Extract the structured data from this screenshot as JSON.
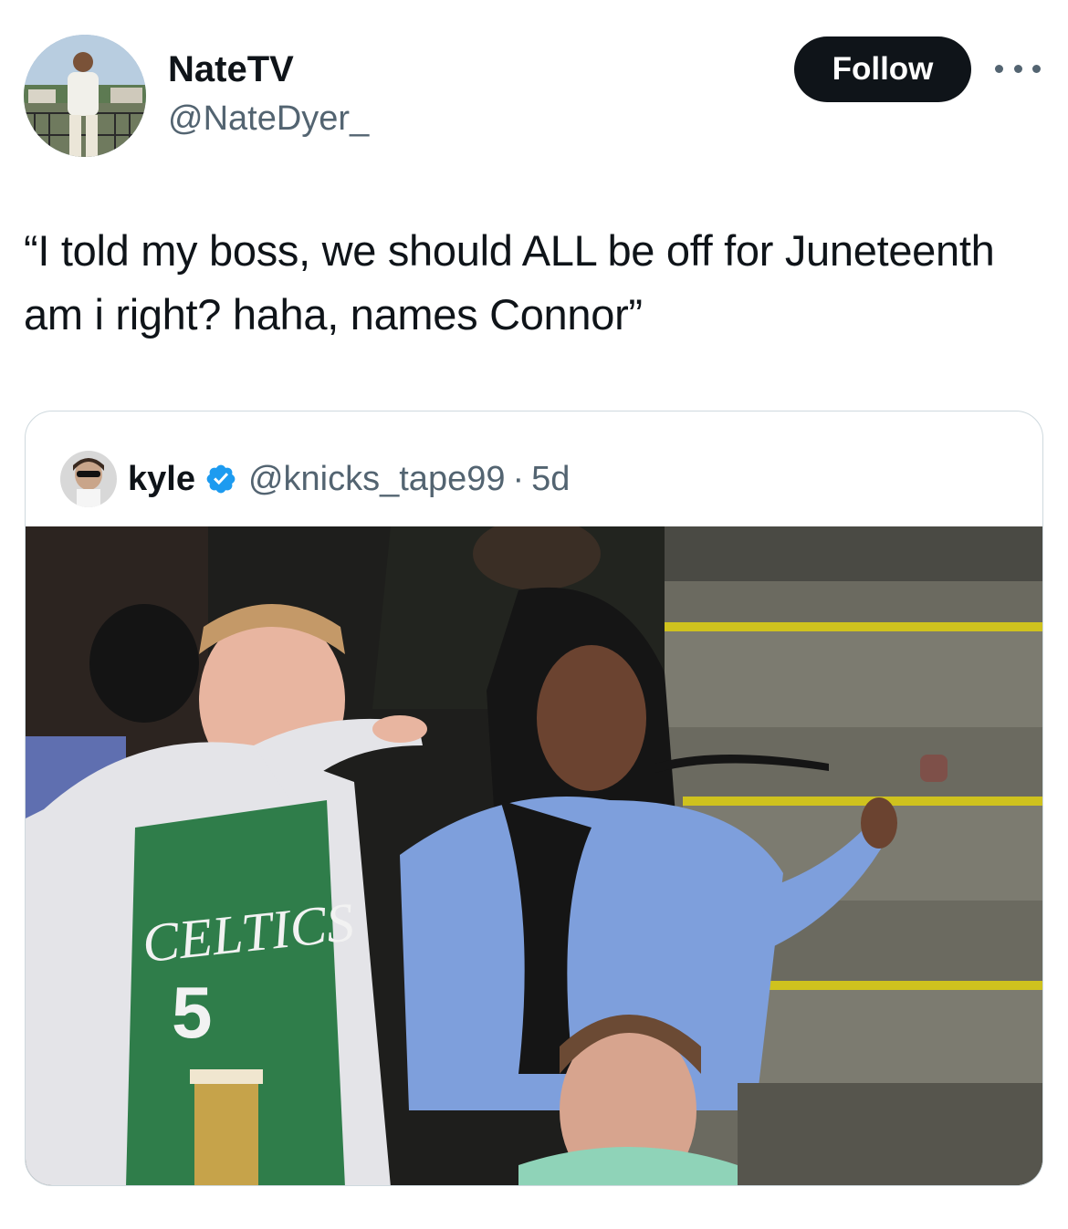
{
  "tweet": {
    "author": {
      "display_name": "NateTV",
      "handle": "@NateDyer_"
    },
    "follow_label": "Follow",
    "more_icon": "more-horizontal-icon",
    "text": "“I told my boss, we should ALL be off for Juneteenth am i right? haha, names Connor”"
  },
  "quoted_tweet": {
    "author": {
      "display_name": "kyle",
      "handle": "@knicks_tape99",
      "verified": true
    },
    "separator": "·",
    "time": "5d"
  },
  "colors": {
    "text_primary": "#0f1419",
    "text_secondary": "#536471",
    "follow_bg": "#0f1419",
    "verified": "#1d9bf0",
    "border": "#cfd9de"
  }
}
